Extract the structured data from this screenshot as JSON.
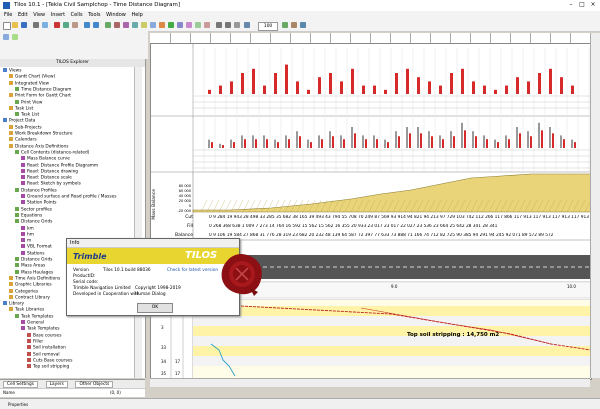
{
  "window": {
    "title": "Tilos 10.1 - [Tekla Civil Samplchop - Time Distance Diagram]",
    "controls": [
      "–",
      "□",
      "×"
    ]
  },
  "menu": [
    "File",
    "Edit",
    "View",
    "Insert",
    "Cells",
    "Tools",
    "Window",
    "Help"
  ],
  "toolbar": {
    "zoom": "100"
  },
  "explorer": {
    "title": "TILOS Explorer",
    "nodes": [
      {
        "label": "Views",
        "indent": 0
      },
      {
        "label": "Gantt Chart (View)",
        "indent": 1
      },
      {
        "label": "Integrated View",
        "indent": 1
      },
      {
        "label": "Time Distance Diagram",
        "indent": 2
      },
      {
        "label": "Print Form for Gantt Chart",
        "indent": 1
      },
      {
        "label": "Print View",
        "indent": 2
      },
      {
        "label": "Task List",
        "indent": 1
      },
      {
        "label": "Task List",
        "indent": 2
      },
      {
        "label": "Project Data",
        "indent": 0
      },
      {
        "label": "Sub-Projects",
        "indent": 1
      },
      {
        "label": "Work Breakdown Structure",
        "indent": 1
      },
      {
        "label": "Calendars",
        "indent": 1
      },
      {
        "label": "Distance Axis Definitions",
        "indent": 1
      },
      {
        "label": "Cell Contents (distance-related)",
        "indent": 2
      },
      {
        "label": "Mass Balance curve",
        "indent": 3
      },
      {
        "label": "Road: Distance Profile Diagramm",
        "indent": 3
      },
      {
        "label": "Road: Distance drawing",
        "indent": 3
      },
      {
        "label": "Road: Distance scale",
        "indent": 3
      },
      {
        "label": "Road: Sketch by symbols",
        "indent": 3
      },
      {
        "label": "Distance Profiles",
        "indent": 2
      },
      {
        "label": "Ground surface and Road profile / Masses",
        "indent": 3
      },
      {
        "label": "Station Points",
        "indent": 3
      },
      {
        "label": "Sector profiles",
        "indent": 2
      },
      {
        "label": "Equations",
        "indent": 2
      },
      {
        "label": "Distance Grids",
        "indent": 2
      },
      {
        "label": "km",
        "indent": 3
      },
      {
        "label": "hm",
        "indent": 3
      },
      {
        "label": "m",
        "indent": 3
      },
      {
        "label": "VBL Format",
        "indent": 3
      },
      {
        "label": "Stations",
        "indent": 3
      },
      {
        "label": "Distance Grids",
        "indent": 2
      },
      {
        "label": "Mass Areas",
        "indent": 2
      },
      {
        "label": "Mass Haulages",
        "indent": 2
      },
      {
        "label": "Time Axis Definitions",
        "indent": 1
      },
      {
        "label": "Graphic Libraries",
        "indent": 1
      },
      {
        "label": "Categories",
        "indent": 1
      },
      {
        "label": "Contract Library",
        "indent": 1
      },
      {
        "label": "Library",
        "indent": 0
      },
      {
        "label": "Task Libraries",
        "indent": 1
      },
      {
        "label": "Task Templates",
        "indent": 2
      },
      {
        "label": "General",
        "indent": 3
      },
      {
        "label": "Task Templates",
        "indent": 3
      },
      {
        "label": "Base courses",
        "indent": 4
      },
      {
        "label": "Filler",
        "indent": 4
      },
      {
        "label": "Soil installation",
        "indent": 4
      },
      {
        "label": "Soil removal",
        "indent": 4
      },
      {
        "label": "Cuts Base courses",
        "indent": 4
      },
      {
        "label": "Top soil stripping",
        "indent": 4
      }
    ],
    "tabs": [
      "Cell Settings",
      "Layers",
      "Other Objects"
    ],
    "name_row": {
      "label": "Name",
      "value": "(0, 0)"
    }
  },
  "status": {
    "left": "Properties",
    "right": ""
  },
  "diagram": {
    "side_label": "Mass Balance",
    "balance_axis": [
      "80 000",
      "60 000",
      "40 000",
      "20 000",
      "0",
      "-20 000"
    ],
    "rows": {
      "cut_label": "Cut",
      "fill_label": "Fill",
      "balance_label": "Balance",
      "cut": "0  9 284  19 943  28 498  33 285  35 682  38 165  39 493  43 794  55 708  70 249  87 569  93 914  94 821  94 213  97 729 103 742 112 266 117 866 117 913 117 913 117 913 117 913",
      "fill": "0    268    368    638    1 009    7 273    14 764    16 592    15 562    15 562    16 355    20 933    23 017    23 017    22 027    23 536    23 664    25 642    28 341    28 341",
      "balance": "0  9 106  19 584  27 868  31 776  28 319  23 682  20 232  48 139  64 587  72 397  77 633  73 888  71 166  74 712  82 725  90 385  94 291  94 245  92 071  89 572  89 572"
    },
    "chainage": {
      "a": "1.0",
      "b": "9.0",
      "c": "10.0"
    },
    "annotation": "Top soil stripping : 14,750 m2",
    "row_numbers": [
      "32",
      "3",
      "33",
      "34",
      "35"
    ],
    "sub_numbers": [
      "",
      "",
      "",
      "17",
      "17"
    ]
  },
  "about_dialog": {
    "title": "Info",
    "brand_left": "Trimble",
    "brand_right": "TILOS",
    "version_label": "Version",
    "version_value": "Tilos 10.1 build 88036",
    "product_label": "ProductID:",
    "serial_label": "Serial code:",
    "company": "Trimble Navigation Limited",
    "copyright": "Copyright 1998-2019",
    "developed": "Developed in Cooperation with",
    "partner": "Human Dialog",
    "check_label": "Check for latest version",
    "ok_label": "OK"
  },
  "chart_data": {
    "type": "bar",
    "series": [
      {
        "values": [
          0,
          7,
          14,
          21,
          35,
          42,
          14,
          35,
          49,
          21,
          7,
          28,
          35,
          21,
          42,
          14,
          14,
          7,
          35,
          42,
          28,
          21,
          14,
          35,
          42,
          21,
          14,
          7,
          14,
          28,
          21,
          35,
          42,
          28,
          14
        ]
      },
      {
        "values": [
          0,
          14,
          7,
          14,
          21,
          21,
          21,
          14,
          21,
          28,
          14,
          21,
          28,
          21,
          35,
          21,
          21,
          14,
          28,
          35,
          35,
          28,
          21,
          28,
          42,
          28,
          21,
          14,
          21,
          35,
          28,
          42,
          35,
          21,
          14
        ]
      }
    ]
  }
}
